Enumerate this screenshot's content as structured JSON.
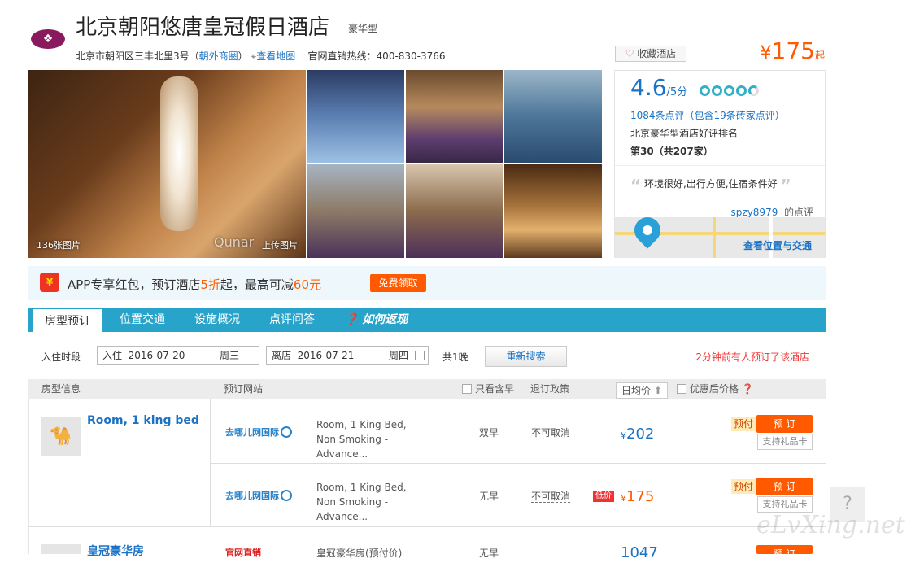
{
  "hotel": {
    "name": "北京朝阳悠唐皇冠假日酒店",
    "star": "豪华型",
    "address": "北京市朝阳区三丰北里3号（",
    "area_link": "朝外商圈",
    "address_end": "）",
    "map_link": "查看地图",
    "hotline_label": "官网直销热线：400-830-3766",
    "price_currency": "¥",
    "price": "175",
    "price_suffix": "起",
    "fav_label": "收藏酒店"
  },
  "gallery": {
    "count_label": "136张图片",
    "upload_label": "上传图片",
    "watermark": "Qunar"
  },
  "rating": {
    "score": "4.6",
    "score_max": "/5分",
    "review_count": "1084条点评（包含19条砖家点评）",
    "rank_label": "北京豪华型酒店好评排名",
    "rank_value": "第30（共207家）",
    "quote": "环境很好,出行方便,住宿条件好",
    "reviewer": "spzy8979",
    "reviewer_suffix": "的点评",
    "map_link": "查看位置与交通",
    "score_fraction": 0.92
  },
  "promo": {
    "text_a": "APP专享红包，预订酒店",
    "discount": "5折",
    "text_b": "起，最高可减",
    "amount": "60元",
    "button": "免费领取",
    "icon_glyph": "¥"
  },
  "tabs": [
    "房型预订",
    "位置交通",
    "设施概况",
    "点评问答",
    "如何返现"
  ],
  "search": {
    "label": "入住时段",
    "checkin_prefix": "入住",
    "checkin_date": "2016-07-20",
    "checkin_weekday": "周三",
    "checkout_prefix": "离店",
    "checkout_date": "2016-07-21",
    "checkout_weekday": "周四",
    "nights": "共1晚",
    "refresh": "重新搜索",
    "notice": "2分钟前有人预订了该酒店"
  },
  "table_header": {
    "room": "房型信息",
    "site": "预订网站",
    "breakfast_only": "只看含早",
    "policy": "退订政策",
    "avg_price": "日均价",
    "discount_price": "优惠后价格"
  },
  "rooms": [
    {
      "name": "Room, 1 king bed",
      "offers": [
        {
          "site": "去哪儿网国际",
          "desc": "Room, 1 King Bed, Non Smoking - Advance...",
          "breakfast": "双早",
          "policy": "不可取消",
          "currency": "¥",
          "price": "202",
          "low_tag": "",
          "prepay": "预付",
          "book": "预 订",
          "gift": "支持礼品卡"
        },
        {
          "site": "去哪儿网国际",
          "desc": "Room, 1 King Bed, Non Smoking - Advance...",
          "breakfast": "无早",
          "policy": "不可取消",
          "currency": "¥",
          "price": "175",
          "low_tag": "低价",
          "prepay": "预付",
          "book": "预 订",
          "gift": "支持礼品卡"
        }
      ]
    },
    {
      "name": "皇冠豪华房",
      "offers": [
        {
          "site": "官网直销",
          "desc": "皇冠豪华房(预付价)",
          "breakfast": "无早",
          "price": "1047",
          "book": "预 订"
        }
      ]
    }
  ],
  "help": "?",
  "watermark": "eLvXing.net",
  "colors": {
    "accent": "#28a3c9",
    "price": "#ff5a00",
    "link": "#1a73c4"
  }
}
